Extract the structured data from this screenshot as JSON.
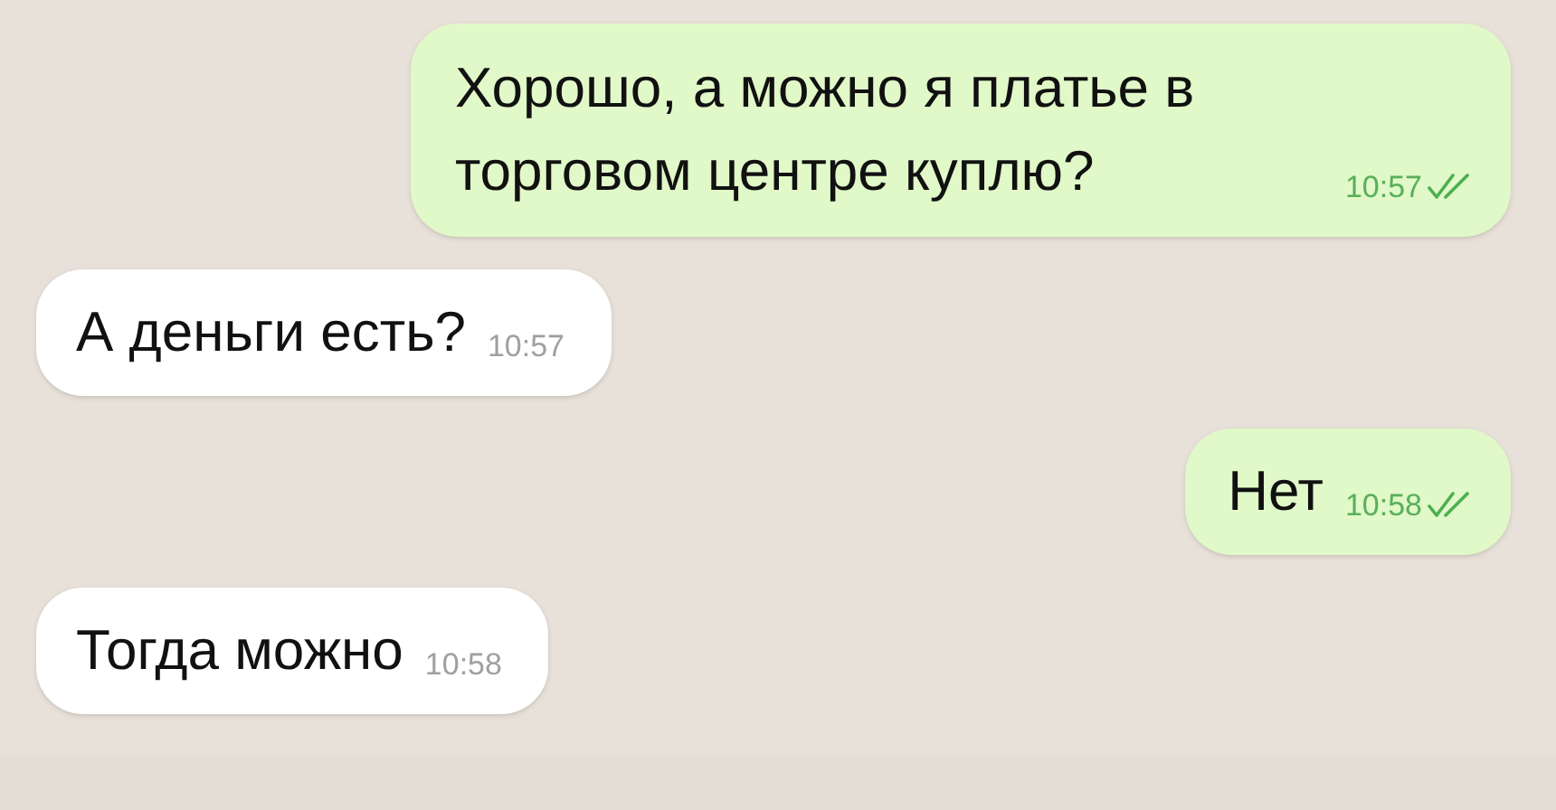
{
  "messages": [
    {
      "kind": "outgoing",
      "text": "Хорошо, а можно я платье в торговом центре куплю?",
      "time": "10:57",
      "read": true
    },
    {
      "kind": "incoming",
      "text": "А деньги есть?",
      "time": "10:57"
    },
    {
      "kind": "outgoing",
      "text": "Нет",
      "time": "10:58",
      "read": true
    },
    {
      "kind": "incoming",
      "text": "Тогда можно",
      "time": "10:58"
    }
  ]
}
